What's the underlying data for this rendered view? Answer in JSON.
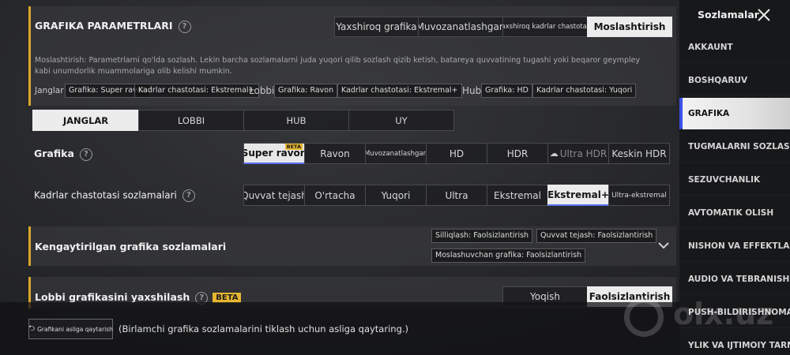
{
  "header": {
    "title": "GRAFIKA PARAMETRLARI",
    "presets": [
      "Yaxshiroq grafika",
      "Muvozanatlashgan",
      "Yaxshiroq kadrlar chastotasi",
      "Moslashtirish"
    ],
    "selected_preset": 3,
    "description": "Moslashtirish: Parametrlarni qo'lda sozlash. Lekin barcha sozlamalarni juda yuqori qilib sozlash qizib ketish, batareya quvvatining tugashi yoki beqaror geympley kabi unumdorlik muammolariga olib kelishi mumkin.",
    "summary": {
      "janglar_label": "Janglar",
      "janglar_tags": [
        "Grafika: Super ravon",
        "Kadrlar chastotasi: Ekstremal+"
      ],
      "lobbi_label": "Lobbi",
      "lobbi_tags": [
        "Grafika: Ravon",
        "Kadrlar chastotasi: Ekstremal+"
      ],
      "hub_label": "Hub",
      "hub_tags": [
        "Grafika: HD",
        "Kadrlar chastotasi: Yuqori"
      ]
    }
  },
  "mode_tabs": [
    "JANGLAR",
    "LOBBI",
    "HUB",
    "UY"
  ],
  "selected_mode": 0,
  "graphics": {
    "label": "Grafika",
    "options": [
      "Super ravon",
      "Ravon",
      "Muvozanatlashgan",
      "HD",
      "HDR",
      "Ultra HDR",
      "Keskin HDR"
    ],
    "beta_label": "BETA"
  },
  "framerate": {
    "label": "Kadrlar chastotasi sozlamalari",
    "options": [
      "Quvvat tejash",
      "O'rtacha",
      "Yuqori",
      "Ultra",
      "Ekstremal",
      "Ekstremal+",
      "Ultra-ekstremal"
    ]
  },
  "advanced": {
    "title": "Kengaytirilgan grafika sozlamalari",
    "tags": [
      "Silliqlash: Faolsizlantirish",
      "Quvvat tejash: Faolsizlantirish",
      "Moslashuvchan grafika: Faolsizlantirish"
    ]
  },
  "lobby": {
    "title": "Lobbi grafikasini yaxshilash",
    "beta": "BETA",
    "options": [
      "Yoqish",
      "Faolsizlantirish"
    ]
  },
  "reset": {
    "button": "Grafikani asliga qaytarish",
    "hint": "(Birlamchi grafika sozlamalarini tiklash uchun asliga qaytaring.)"
  },
  "sidebar": {
    "title": "Sozlamalar",
    "items": [
      "AKKAUNT",
      "BOSHQARUV",
      "GRAFIKA",
      "TUGMALARNI SOZLASH",
      "SEZUVCHANLIK",
      "AVTOMATIK OLISH",
      "NISHON VA EFFEKTLAR",
      "AUDIO VA TEBRANISH",
      "PUSH-BILDIRISHNOMALAR",
      "YLIK VA IJTIMOIY TARMO"
    ],
    "active": 2
  },
  "watermark": "olx.uz"
}
